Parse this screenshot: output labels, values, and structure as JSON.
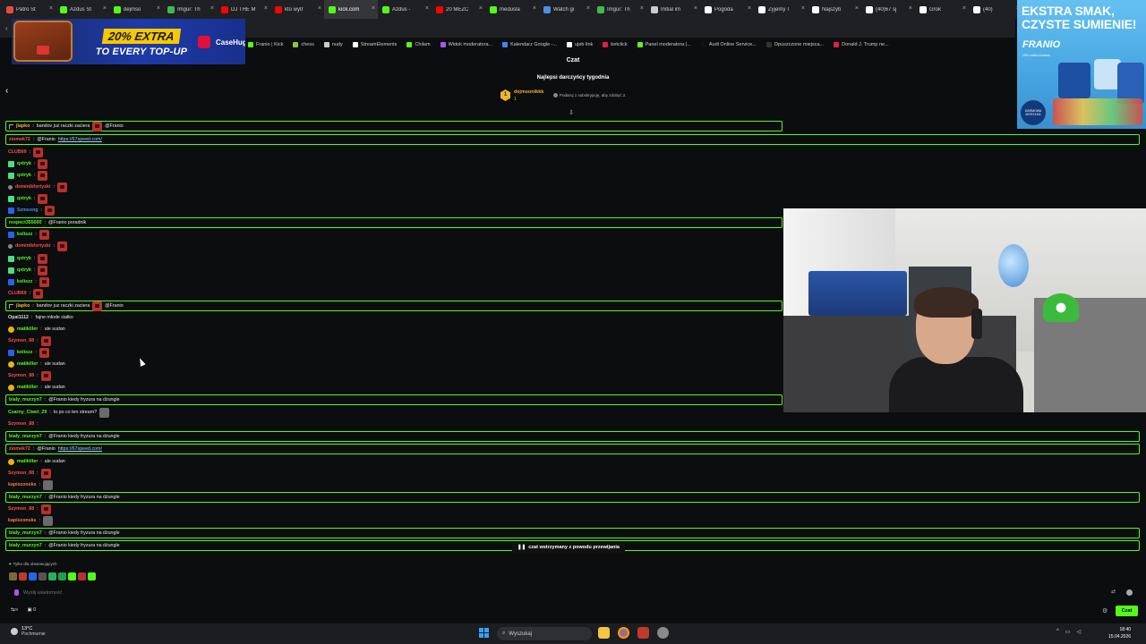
{
  "browser": {
    "tabs": [
      {
        "title": "Patro St",
        "color": "#e74c3c"
      },
      {
        "title": "Azdus St",
        "color": "#53fc18"
      },
      {
        "title": "dejmso",
        "color": "#53fc18"
      },
      {
        "title": "Imgur: Th",
        "color": "#3fb950"
      },
      {
        "title": "DJ THE M",
        "color": "#ff0000"
      },
      {
        "title": "kto wytr",
        "color": "#ff0000"
      },
      {
        "title": "kick.com",
        "color": "#53fc18"
      },
      {
        "title": "Azdus -",
        "color": "#53fc18"
      },
      {
        "title": "20 MEZC",
        "color": "#ff0000"
      },
      {
        "title": "medusla",
        "color": "#53fc18"
      },
      {
        "title": "Watch gi",
        "color": "#4a90e2"
      },
      {
        "title": "Imgur: Th",
        "color": "#3fb950"
      },
      {
        "title": "Initial im",
        "color": "#cccccc"
      },
      {
        "title": "Pogoda",
        "color": "#ffffff"
      },
      {
        "title": "Żyjemy T",
        "color": "#ffffff"
      },
      {
        "title": "Najszyb",
        "color": "#ffffff"
      },
      {
        "title": "(40)67 sj",
        "color": "#ffffff"
      },
      {
        "title": "Grok",
        "color": "#ffffff"
      },
      {
        "title": "(40)",
        "color": "#ffffff"
      }
    ],
    "active_tab_index": 6,
    "bookmarks": [
      {
        "label": "Franio | Kick",
        "color": "#53fc18"
      },
      {
        "label": "chess",
        "color": "#8bc34a"
      },
      {
        "label": "nudy",
        "color": "#cccccc"
      },
      {
        "label": "StreamElements",
        "color": "#ffffff"
      },
      {
        "label": "Chilam",
        "color": "#53fc18"
      },
      {
        "label": "Widok moderatora...",
        "color": "#a855f7"
      },
      {
        "label": "Kalendarz Google -...",
        "color": "#4285f4"
      },
      {
        "label": "ujeb link",
        "color": "#ffffff"
      },
      {
        "label": "betclick",
        "color": "#e11d48"
      },
      {
        "label": "Panel moderatora |...",
        "color": "#53fc18"
      },
      {
        "label": "Audi Online Service...",
        "color": "#111111"
      },
      {
        "label": "Opuszczone miejsca...",
        "color": "#333333"
      },
      {
        "label": "Donald J. Trump ne...",
        "color": "#e11d48"
      }
    ]
  },
  "ads": {
    "left": {
      "headline": "20% EXTRA",
      "subline": "TO EVERY TOP-UP",
      "brand": "CaseHug"
    },
    "right": {
      "headline": "EKSTRA SMAK, CZYSTE SUMIENIE!",
      "brand": "FRANIO",
      "tagline": "10% zniżki z kodem",
      "badge": "DARMOWA WYSYŁKA"
    }
  },
  "chat": {
    "title": "Czat",
    "top_gifters_title": "Najlepsi darczyńcy tygodnia",
    "top_gifter": {
      "rank": "1",
      "name": "dejmsonikkk",
      "count": "1"
    },
    "gift_hint": "Podaruj 1 subskrypcję, aby zdobyć 2.",
    "paused_banner": "czat wstrzymany z powodu przewijania",
    "followers_only": "Tylko dla obserwujących",
    "input_placeholder": "Wyślij wiadomość",
    "points_value": "0",
    "send_label": "Czat",
    "messages": [
      {
        "user": "jlapko",
        "color": "#f0b429",
        "text": "bandov juz raczki zaciera",
        "mention": "@Franio",
        "hl": "short",
        "emote": true,
        "reply": true
      },
      {
        "user": "ziomek72",
        "color": "#ff4d4d",
        "text": "@Franio",
        "link": "https://67speed.com/",
        "hl": "long"
      },
      {
        "user": "CLUB69",
        "color": "#ff4d4d",
        "text": "",
        "emote": true
      },
      {
        "user": "qxtryk",
        "color": "#53fc18",
        "text": "",
        "emote": true,
        "badge": "sub"
      },
      {
        "user": "qxtryk",
        "color": "#53fc18",
        "text": "",
        "emote": true,
        "badge": "sub"
      },
      {
        "user": "dominikfortyski",
        "color": "#ff4d4d",
        "text": "",
        "emote": true,
        "badge": "gray"
      },
      {
        "user": "qxtryk",
        "color": "#53fc18",
        "text": "",
        "emote": true,
        "badge": "sub"
      },
      {
        "user": "Szmeong",
        "color": "#4a90e2",
        "text": "",
        "emote": true,
        "badge": "mod"
      },
      {
        "user": "respect355000",
        "color": "#53fc18",
        "text": "@Franio poradnik",
        "hl": "short"
      },
      {
        "user": "koliszz",
        "color": "#53fc18",
        "text": "",
        "emote": true,
        "badge": "mod"
      },
      {
        "user": "dominikfortyski",
        "color": "#ff4d4d",
        "text": "",
        "emote": true,
        "badge": "gray"
      },
      {
        "user": "qxtryk",
        "color": "#53fc18",
        "text": "",
        "emote": true,
        "badge": "sub"
      },
      {
        "user": "qxtryk",
        "color": "#53fc18",
        "text": "",
        "emote": true,
        "badge": "sub"
      },
      {
        "user": "koliszz",
        "color": "#53fc18",
        "text": "",
        "emote": true,
        "badge": "mod"
      },
      {
        "user": "CLUB69",
        "color": "#ff4d4d",
        "text": "",
        "emote": true
      },
      {
        "user": "jlapko",
        "color": "#f0b429",
        "text": "bandov juz raczki zaciera",
        "mention": "@Franio",
        "hl": "short",
        "emote": true,
        "reply": true
      },
      {
        "user": "Opal1112",
        "color": "#dddddd",
        "text": "fajne młode ciałko"
      },
      {
        "user": "matikiller",
        "color": "#53fc18",
        "text": "ale sudan",
        "badge": "gold"
      },
      {
        "user": "Szymon_88",
        "color": "#ff4d4d",
        "text": "",
        "emote": true
      },
      {
        "user": "koliszz",
        "color": "#53fc18",
        "text": "",
        "emote": true,
        "badge": "mod"
      },
      {
        "user": "matikiller",
        "color": "#53fc18",
        "text": "ale sudan",
        "badge": "gold"
      },
      {
        "user": "Szymon_88",
        "color": "#ff4d4d",
        "text": "",
        "emote": true
      },
      {
        "user": "matikiller",
        "color": "#53fc18",
        "text": "ale sudan",
        "badge": "gold"
      },
      {
        "user": "bialy_murzyn7",
        "color": "#53fc18",
        "text": "@Franio kiedy fryzura na dżungle",
        "hl": "short"
      },
      {
        "user": "Czarny_Ciwel_29",
        "color": "#53fc18",
        "text": "to po co ten stream?",
        "emote2": true
      },
      {
        "user": "Szymon_88",
        "color": "#ff4d4d",
        "text": ""
      },
      {
        "user": "bialy_murzyn7",
        "color": "#53fc18",
        "text": "@Franio kiedy fryzura na dżungle",
        "hl": "long"
      },
      {
        "user": "ziomek72",
        "color": "#ff4d4d",
        "text": "@Franio",
        "link": "https://67speed.com/",
        "hl": "long"
      },
      {
        "user": "matikiller",
        "color": "#53fc18",
        "text": "ale sudan",
        "badge": "gold"
      },
      {
        "user": "Szymon_88",
        "color": "#ff4d4d",
        "text": "",
        "emote": true
      },
      {
        "user": "kapiszonsks",
        "color": "#ff7a45",
        "text": "",
        "emote2": true
      },
      {
        "user": "bialy_murzyn7",
        "color": "#53fc18",
        "text": "@Franio kiedy fryzura na dżungle",
        "hl": "long"
      },
      {
        "user": "Szymon_88",
        "color": "#ff4d4d",
        "text": "",
        "emote": true
      },
      {
        "user": "kapiszonsks",
        "color": "#ff7a45",
        "text": "",
        "emote2": true
      },
      {
        "user": "bialy_murzyn7",
        "color": "#53fc18",
        "text": "@Franio kiedy fryzura na dżungle",
        "hl": "long"
      },
      {
        "user": "bialy_murzyn7",
        "color": "#53fc18",
        "text": "@Franio kiedy fryzura na dżungle",
        "hl": "long"
      }
    ]
  },
  "taskbar": {
    "weather_temp": "13°C",
    "weather_desc": "Pochmurnie",
    "search_placeholder": "Wyszukaj",
    "time": "18:40",
    "date": "15.04.2026"
  }
}
